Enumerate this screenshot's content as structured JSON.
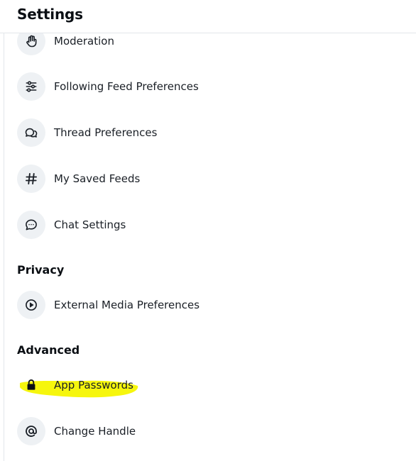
{
  "header": {
    "title": "Settings"
  },
  "sections": {
    "privacy": "Privacy",
    "advanced": "Advanced"
  },
  "rows": {
    "moderation": {
      "label": "Moderation",
      "icon": "hand-icon"
    },
    "following_feed": {
      "label": "Following Feed Preferences",
      "icon": "sliders-icon"
    },
    "thread": {
      "label": "Thread Preferences",
      "icon": "chat-bubbles-icon"
    },
    "saved_feeds": {
      "label": "My Saved Feeds",
      "icon": "hashtag-icon"
    },
    "chat": {
      "label": "Chat Settings",
      "icon": "message-icon"
    },
    "external_media": {
      "label": "External Media Preferences",
      "icon": "play-icon"
    },
    "app_passwords": {
      "label": "App Passwords",
      "icon": "lock-icon"
    },
    "change_handle": {
      "label": "Change Handle",
      "icon": "at-icon"
    }
  },
  "colors": {
    "highlight": "#f5f500",
    "icon_bg": "#eef1f4",
    "text": "#1a1f26",
    "divider": "#e3e6ea"
  }
}
